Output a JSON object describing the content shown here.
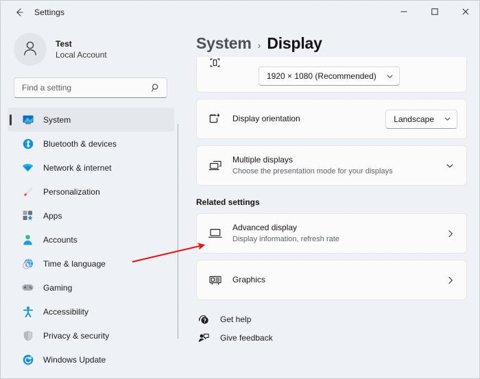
{
  "window": {
    "title": "Settings",
    "back_icon": "back-arrow-icon",
    "minimize_label": "–",
    "maximize_label": "□",
    "close_label": "×"
  },
  "sidebar": {
    "account": {
      "name": "Test",
      "subtitle": "Local Account",
      "avatar_icon": "person-avatar-icon"
    },
    "search": {
      "placeholder": "Find a setting",
      "value": "",
      "icon": "search-icon"
    },
    "items": [
      {
        "label": "System",
        "icon": "system-icon",
        "selected": true
      },
      {
        "label": "Bluetooth & devices",
        "icon": "bluetooth-icon",
        "selected": false
      },
      {
        "label": "Network & internet",
        "icon": "network-wifi-icon",
        "selected": false
      },
      {
        "label": "Personalization",
        "icon": "paintbrush-icon",
        "selected": false
      },
      {
        "label": "Apps",
        "icon": "apps-icon",
        "selected": false
      },
      {
        "label": "Accounts",
        "icon": "accounts-person-icon",
        "selected": false
      },
      {
        "label": "Time & language",
        "icon": "clock-globe-icon",
        "selected": false
      },
      {
        "label": "Gaming",
        "icon": "gamepad-icon",
        "selected": false
      },
      {
        "label": "Accessibility",
        "icon": "accessibility-icon",
        "selected": false
      },
      {
        "label": "Privacy & security",
        "icon": "shield-icon",
        "selected": false
      },
      {
        "label": "Windows Update",
        "icon": "windows-update-icon",
        "selected": false
      }
    ]
  },
  "main": {
    "breadcrumb": {
      "parent": "System",
      "separator": "›",
      "current": "Display"
    },
    "resolution_card": {
      "icon": "resolution-icon",
      "value": "1920 × 1080 (Recommended)",
      "chevron_icon": "chevron-down-icon"
    },
    "orientation_card": {
      "icon": "display-orientation-icon",
      "title": "Display orientation",
      "value": "Landscape",
      "chevron_icon": "chevron-down-icon"
    },
    "multiple_displays_card": {
      "icon": "multiple-displays-icon",
      "title": "Multiple displays",
      "subtitle": "Choose the presentation mode for your displays",
      "chevron_icon": "chevron-down-icon"
    },
    "related_settings_heading": "Related settings",
    "related": [
      {
        "icon": "laptop-display-icon",
        "title": "Advanced display",
        "subtitle": "Display information, refresh rate",
        "chevron_icon": "chevron-right-icon"
      },
      {
        "icon": "graphics-card-icon",
        "title": "Graphics",
        "subtitle": "",
        "chevron_icon": "chevron-right-icon"
      }
    ],
    "footer_links": [
      {
        "label": "Get help",
        "icon": "get-help-icon"
      },
      {
        "label": "Give feedback",
        "icon": "give-feedback-icon"
      }
    ]
  },
  "annotation": {
    "arrow_color": "#ee1111",
    "target": "Advanced display"
  },
  "colors": {
    "page_background": "#eef1f6",
    "card_background": "#fbfbfc",
    "accent_selection": "#e4e7ec",
    "selection_bar": "#3a3a3a",
    "text_primary": "#151515",
    "text_secondary": "#5e6166"
  }
}
